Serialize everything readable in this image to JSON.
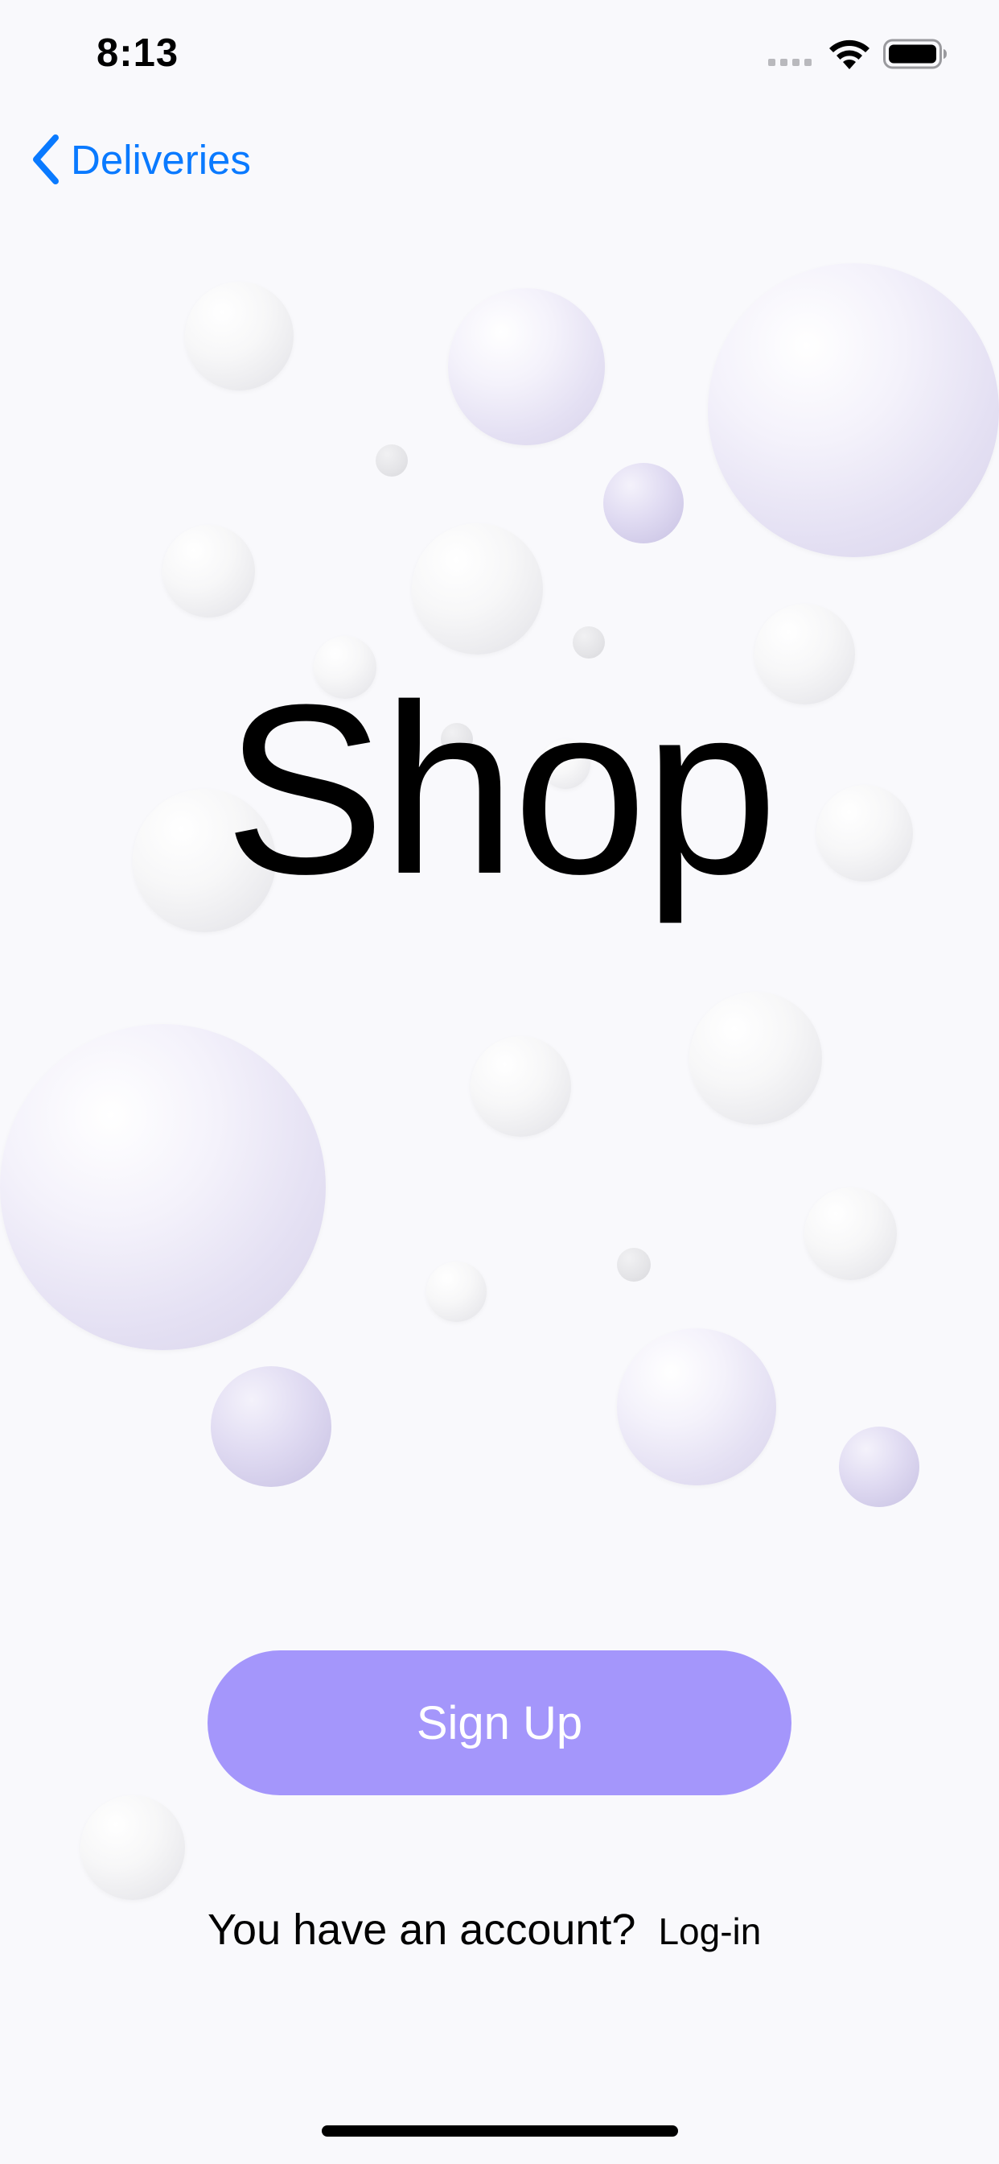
{
  "status_bar": {
    "time": "8:13",
    "signal_icon": "signal-dots-icon",
    "wifi_icon": "wifi-icon",
    "battery_icon": "battery-icon"
  },
  "nav": {
    "back_icon": "chevron-left-icon",
    "back_label": "Deliveries"
  },
  "main": {
    "title": "Shop"
  },
  "actions": {
    "signup_label": "Sign Up",
    "account_question": "You have an account?",
    "login_label": "Log-in"
  },
  "colors": {
    "accent": "#a496fb",
    "link": "#0a7aff",
    "background": "#f9f9fc",
    "bubble_lavender": "#d8d3ea"
  }
}
